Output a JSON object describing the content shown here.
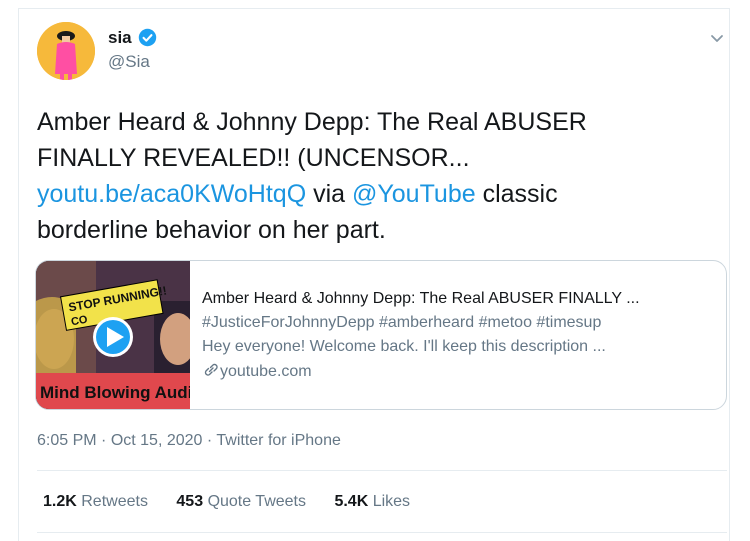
{
  "author": {
    "name": "sia",
    "handle": "@Sia",
    "verified": true
  },
  "tweet": {
    "text_line1": "Amber Heard & Johnny Depp:  The Real ABUSER",
    "text_line2": "FINALLY REVEALED!! (UNCENSOR...",
    "link_url": "youtu.be/aca0KWoHtqQ",
    "via_text": " via ",
    "mention": "@YouTube",
    "text_after_mention": " classic",
    "text_line4": "borderline behavior on her part."
  },
  "card": {
    "thumb_banner_top": "STOP RUNNING!!",
    "thumb_banner_top2": "CO",
    "thumb_caption": "Mind Blowing Audio",
    "title": "Amber Heard & Johnny Depp: The Real ABUSER FINALLY ...",
    "tags": "#JusticeForJohnnyDepp #amberheard #metoo #timesup",
    "description": "Hey everyone! Welcome back. I'll keep this description ...",
    "domain": "youtube.com"
  },
  "meta": {
    "time": "6:05 PM",
    "separator": " · ",
    "date": "Oct 15, 2020",
    "source": "Twitter for iPhone"
  },
  "stats": {
    "retweets_count": "1.2K",
    "retweets_label": "Retweets",
    "quotes_count": "453",
    "quotes_label": "Quote Tweets",
    "likes_count": "5.4K",
    "likes_label": "Likes"
  },
  "colors": {
    "link": "#1b95e0",
    "secondary": "#657786",
    "avatar_bg": "#f6b93b",
    "verified": "#1da1f2"
  }
}
